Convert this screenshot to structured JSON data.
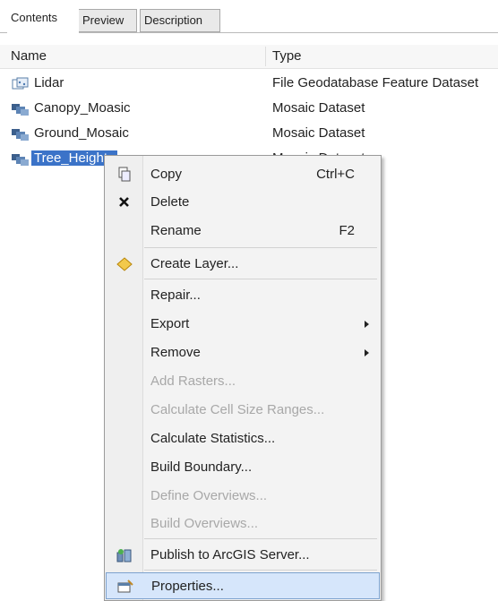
{
  "tabs": {
    "contents": "Contents",
    "preview": "Preview",
    "description": "Description"
  },
  "columns": {
    "name": "Name",
    "type": "Type"
  },
  "rows": [
    {
      "name": "Lidar",
      "type": "File Geodatabase Feature Dataset",
      "icon": "feature-dataset-icon"
    },
    {
      "name": "Canopy_Moasic",
      "type": "Mosaic Dataset",
      "icon": "mosaic-dataset-icon"
    },
    {
      "name": "Ground_Mosaic",
      "type": "Mosaic Dataset",
      "icon": "mosaic-dataset-icon"
    },
    {
      "name": "Tree_Heights",
      "type": "Mosaic Dataset",
      "icon": "mosaic-dataset-icon",
      "selected": true
    }
  ],
  "menu": {
    "copy": {
      "label": "Copy",
      "shortcut": "Ctrl+C",
      "icon": "copy-icon"
    },
    "delete": {
      "label": "Delete",
      "icon": "delete-x-icon"
    },
    "rename": {
      "label": "Rename",
      "shortcut": "F2"
    },
    "create_layer": {
      "label": "Create Layer...",
      "icon": "layer-diamond-icon"
    },
    "repair": {
      "label": "Repair..."
    },
    "export": {
      "label": "Export"
    },
    "remove": {
      "label": "Remove"
    },
    "add_rasters": {
      "label": "Add Rasters...",
      "disabled": true
    },
    "calc_cell_size": {
      "label": "Calculate Cell Size Ranges...",
      "disabled": true
    },
    "calc_stats": {
      "label": "Calculate Statistics..."
    },
    "build_boundary": {
      "label": "Build Boundary..."
    },
    "define_overviews": {
      "label": "Define Overviews...",
      "disabled": true
    },
    "build_overviews": {
      "label": "Build Overviews...",
      "disabled": true
    },
    "publish": {
      "label": "Publish to ArcGIS Server...",
      "icon": "publish-server-icon"
    },
    "properties": {
      "label": "Properties...",
      "icon": "properties-icon",
      "highlighted": true
    }
  },
  "colors": {
    "selection": "#3b73c8",
    "hover": "#d6e6fb",
    "disabled_text": "#a8a8a8"
  }
}
